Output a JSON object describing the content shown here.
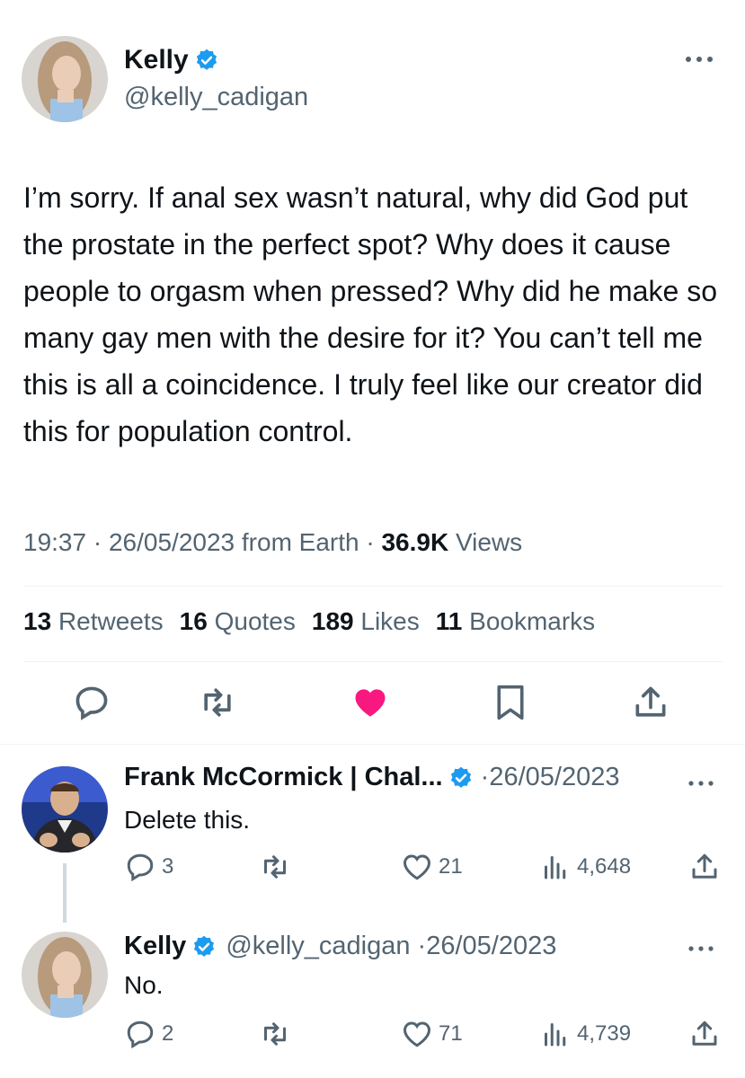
{
  "main_tweet": {
    "author_name": "Kelly",
    "author_handle": "@kelly_cadigan",
    "text": "I’m sorry. If anal sex wasn’t natural, why did God put the prostate in the perfect spot? Why does it cause people to orgasm when pressed? Why did he make so many gay men with the desire for it? You can’t tell me this is all a coincidence. I truly feel like our creator did this for population control.",
    "time": "19:37",
    "date": "26/05/2023",
    "source": "from Earth",
    "views_count": "36.9K",
    "views_label": "Views",
    "stats": {
      "retweets_count": "13",
      "retweets_label": "Retweets",
      "quotes_count": "16",
      "quotes_label": "Quotes",
      "likes_count": "189",
      "likes_label": "Likes",
      "bookmarks_count": "11",
      "bookmarks_label": "Bookmarks"
    },
    "liked": true
  },
  "replies": [
    {
      "author_name": "Frank McCormick | Chal...",
      "date": "26/05/2023",
      "text": "Delete this.",
      "reply_count": "3",
      "retweet_count": "",
      "like_count": "21",
      "views_count": "4,648"
    },
    {
      "author_name": "Kelly",
      "author_handle": "@kelly_cadigan",
      "date": "26/05/2023",
      "text": "No.",
      "reply_count": "2",
      "retweet_count": "",
      "like_count": "71",
      "views_count": "4,739"
    }
  ],
  "colors": {
    "verified": "#1d9bf0",
    "like_active": "#f91880",
    "text_primary": "#0f1419",
    "text_secondary": "#536471"
  },
  "icons": [
    "verified-badge-icon",
    "more-icon",
    "reply-icon",
    "retweet-icon",
    "like-icon",
    "bookmark-icon",
    "share-icon",
    "views-icon"
  ]
}
